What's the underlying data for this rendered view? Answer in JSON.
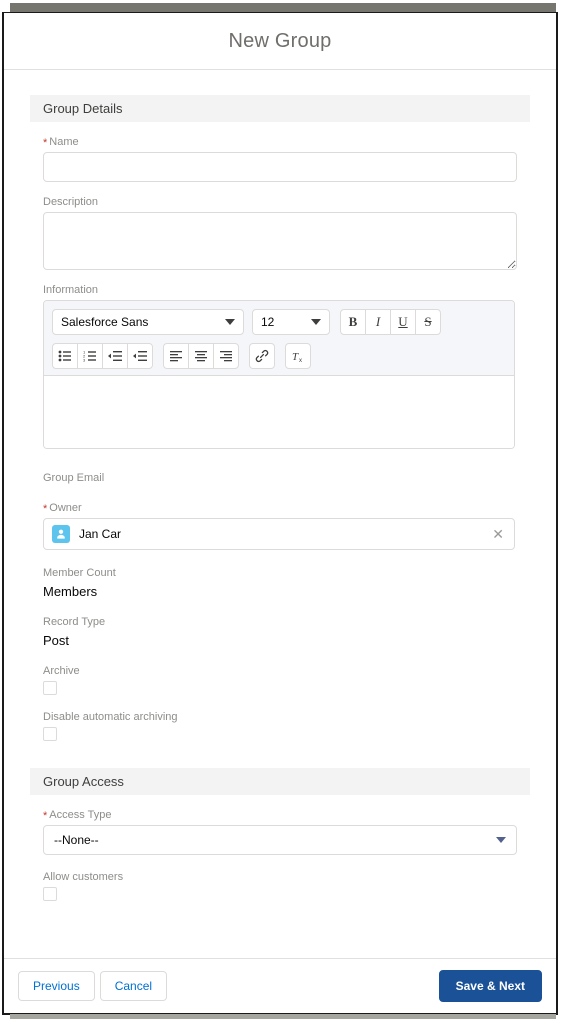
{
  "modal": {
    "title": "New Group"
  },
  "sections": {
    "group_details": {
      "header": "Group Details",
      "name": {
        "label": "Name",
        "required": true,
        "value": "",
        "placeholder": ""
      },
      "description": {
        "label": "Description",
        "required": false,
        "value": "",
        "placeholder": ""
      },
      "information": {
        "label": "Information",
        "value": "",
        "toolbar": {
          "font_family": "Salesforce Sans",
          "font_size": "12",
          "format_buttons": [
            {
              "name": "bold-button",
              "glyph": "B"
            },
            {
              "name": "italic-button",
              "glyph": "I"
            },
            {
              "name": "underline-button",
              "glyph": "U"
            },
            {
              "name": "strikethrough-button",
              "glyph": "S"
            }
          ],
          "list_buttons": [
            {
              "name": "bulleted-list-button"
            },
            {
              "name": "numbered-list-button"
            },
            {
              "name": "indent-decrease-button"
            },
            {
              "name": "indent-increase-button"
            }
          ],
          "align_buttons": [
            {
              "name": "align-left-button"
            },
            {
              "name": "align-center-button"
            },
            {
              "name": "align-right-button"
            }
          ],
          "link_button": {
            "name": "insert-link-button"
          },
          "clear_format_button": {
            "name": "remove-formatting-button"
          }
        }
      },
      "group_email": {
        "label": "Group Email",
        "value": ""
      },
      "owner": {
        "label": "Owner",
        "required": true,
        "value": "Jan Car",
        "avatar_icon": "user-avatar-icon",
        "clear_icon": "✕"
      },
      "member_count": {
        "label": "Member Count",
        "value": "Members"
      },
      "record_type": {
        "label": "Record Type",
        "value": "Post"
      },
      "archive": {
        "label": "Archive",
        "checked": false
      },
      "disable_automatic_archiving": {
        "label": "Disable automatic archiving",
        "checked": false
      }
    },
    "group_access": {
      "header": "Group Access",
      "access_type": {
        "label": "Access Type",
        "required": true,
        "value": "--None--",
        "options": [
          "--None--"
        ]
      },
      "allow_customers": {
        "label": "Allow customers",
        "checked": false
      }
    }
  },
  "footer": {
    "previous_label": "Previous",
    "cancel_label": "Cancel",
    "save_next_label": "Save & Next"
  },
  "colors": {
    "brand_blue": "#1b5297",
    "link_blue": "#0070d2",
    "required_red": "#c23934",
    "avatar_cyan": "#5cc4ed",
    "section_bg": "#f3f3f3"
  }
}
